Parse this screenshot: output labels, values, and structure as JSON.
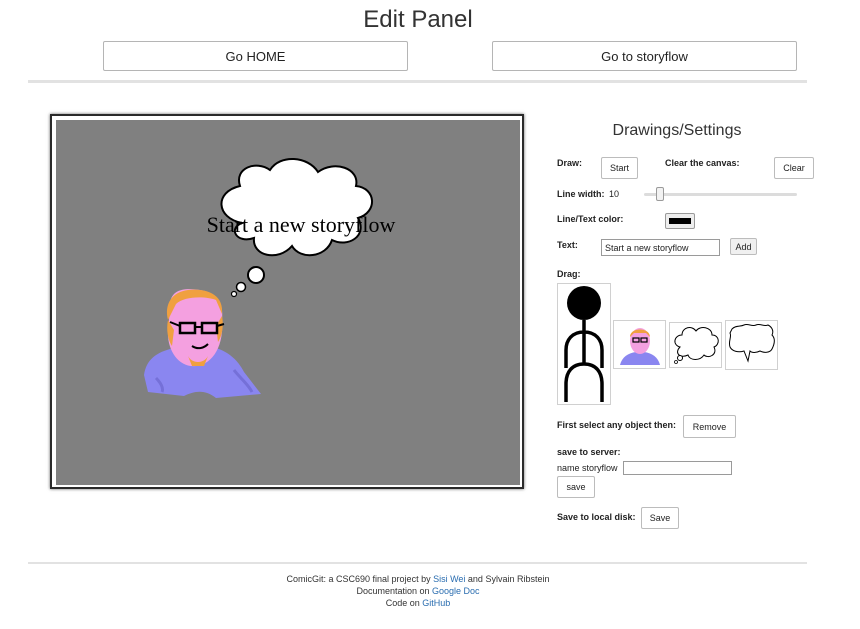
{
  "header": {
    "title": "Edit Panel",
    "home_button": "Go HOME",
    "storyflow_button": "Go to storyflow"
  },
  "canvas": {
    "background_color": "#808080",
    "bubble_text": "Start a new storyflow"
  },
  "settings": {
    "title": "Drawings/Settings",
    "draw_label": "Draw:",
    "draw_button": "Start",
    "clear_label": "Clear the canvas:",
    "clear_button": "Clear",
    "line_width_label": "Line width:",
    "line_width_value": "10",
    "line_width_slider_fraction": 0.08,
    "color_label": "Line/Text color:",
    "line_color": "#000000",
    "text_label": "Text:",
    "text_value": "Start a new storyflow",
    "add_button": "Add",
    "drag_label": "Drag:",
    "drag_items": [
      "stick-figure",
      "person-portrait",
      "thought-bubble",
      "speech-bubble"
    ],
    "remove_label": "First select any object then:",
    "remove_button": "Remove",
    "server_label": "save to server:",
    "name_label": "name storyflow",
    "name_value": "",
    "server_save_button": "save",
    "disk_label": "Save to local disk:",
    "disk_save_button": "Save"
  },
  "footer": {
    "line1_prefix": "ComicGit: a CSC690 final project by ",
    "author1": "Sisi Wei",
    "line1_middle": " and ",
    "author2": "Sylvain Ribstein",
    "line2_prefix": "Documentation on ",
    "doc_link": "Google Doc",
    "line3_prefix": "Code on ",
    "code_link": "GitHub",
    "link_color": "#2a6db0"
  }
}
